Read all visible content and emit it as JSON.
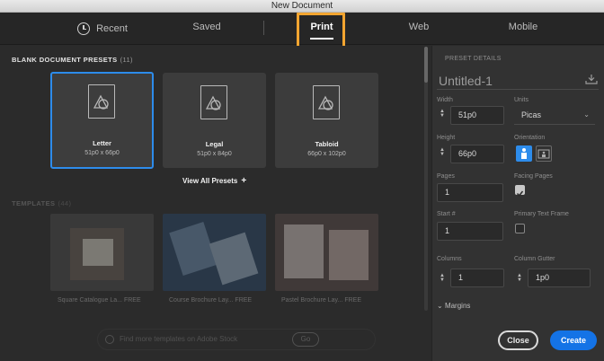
{
  "window": {
    "title": "New Document"
  },
  "tabs": {
    "recent": "Recent",
    "saved": "Saved",
    "print": "Print",
    "web": "Web",
    "mobile": "Mobile",
    "active": "Print"
  },
  "presets_section": {
    "title": "BLANK DOCUMENT PRESETS",
    "count": "(11)"
  },
  "presets": [
    {
      "name": "Letter",
      "size": "51p0 x 66p0",
      "selected": true
    },
    {
      "name": "Legal",
      "size": "51p0 x 84p0",
      "selected": false
    },
    {
      "name": "Tabloid",
      "size": "66p0 x 102p0",
      "selected": false
    }
  ],
  "view_all": {
    "label": "View All Presets",
    "icon": "plus-icon"
  },
  "templates_section": {
    "title": "TEMPLATES",
    "count": "(44)"
  },
  "templates": [
    {
      "label": "Square Catalogue La...",
      "badge": "FREE"
    },
    {
      "label": "Course Brochure Lay...",
      "badge": "FREE"
    },
    {
      "label": "Pastel Brochure Lay...",
      "badge": "FREE"
    }
  ],
  "search": {
    "placeholder": "Find more templates on Adobe Stock",
    "go_label": "Go"
  },
  "details": {
    "header": "PRESET DETAILS",
    "doc_name": "Untitled-1",
    "width_label": "Width",
    "width_value": "51p0",
    "units_label": "Units",
    "units_value": "Picas",
    "height_label": "Height",
    "height_value": "66p0",
    "orientation_label": "Orientation",
    "orientation": "portrait",
    "pages_label": "Pages",
    "pages_value": "1",
    "facing_pages_label": "Facing Pages",
    "facing_pages": true,
    "start_label": "Start #",
    "start_value": "1",
    "primary_text_frame_label": "Primary Text Frame",
    "primary_text_frame": false,
    "columns_label": "Columns",
    "columns_value": "1",
    "gutter_label": "Column Gutter",
    "gutter_value": "1p0",
    "margins_label": "Margins"
  },
  "buttons": {
    "close": "Close",
    "create": "Create"
  },
  "colors": {
    "accent": "#1473e6",
    "selection": "#2d8ceb",
    "highlight": "#f3a530"
  }
}
